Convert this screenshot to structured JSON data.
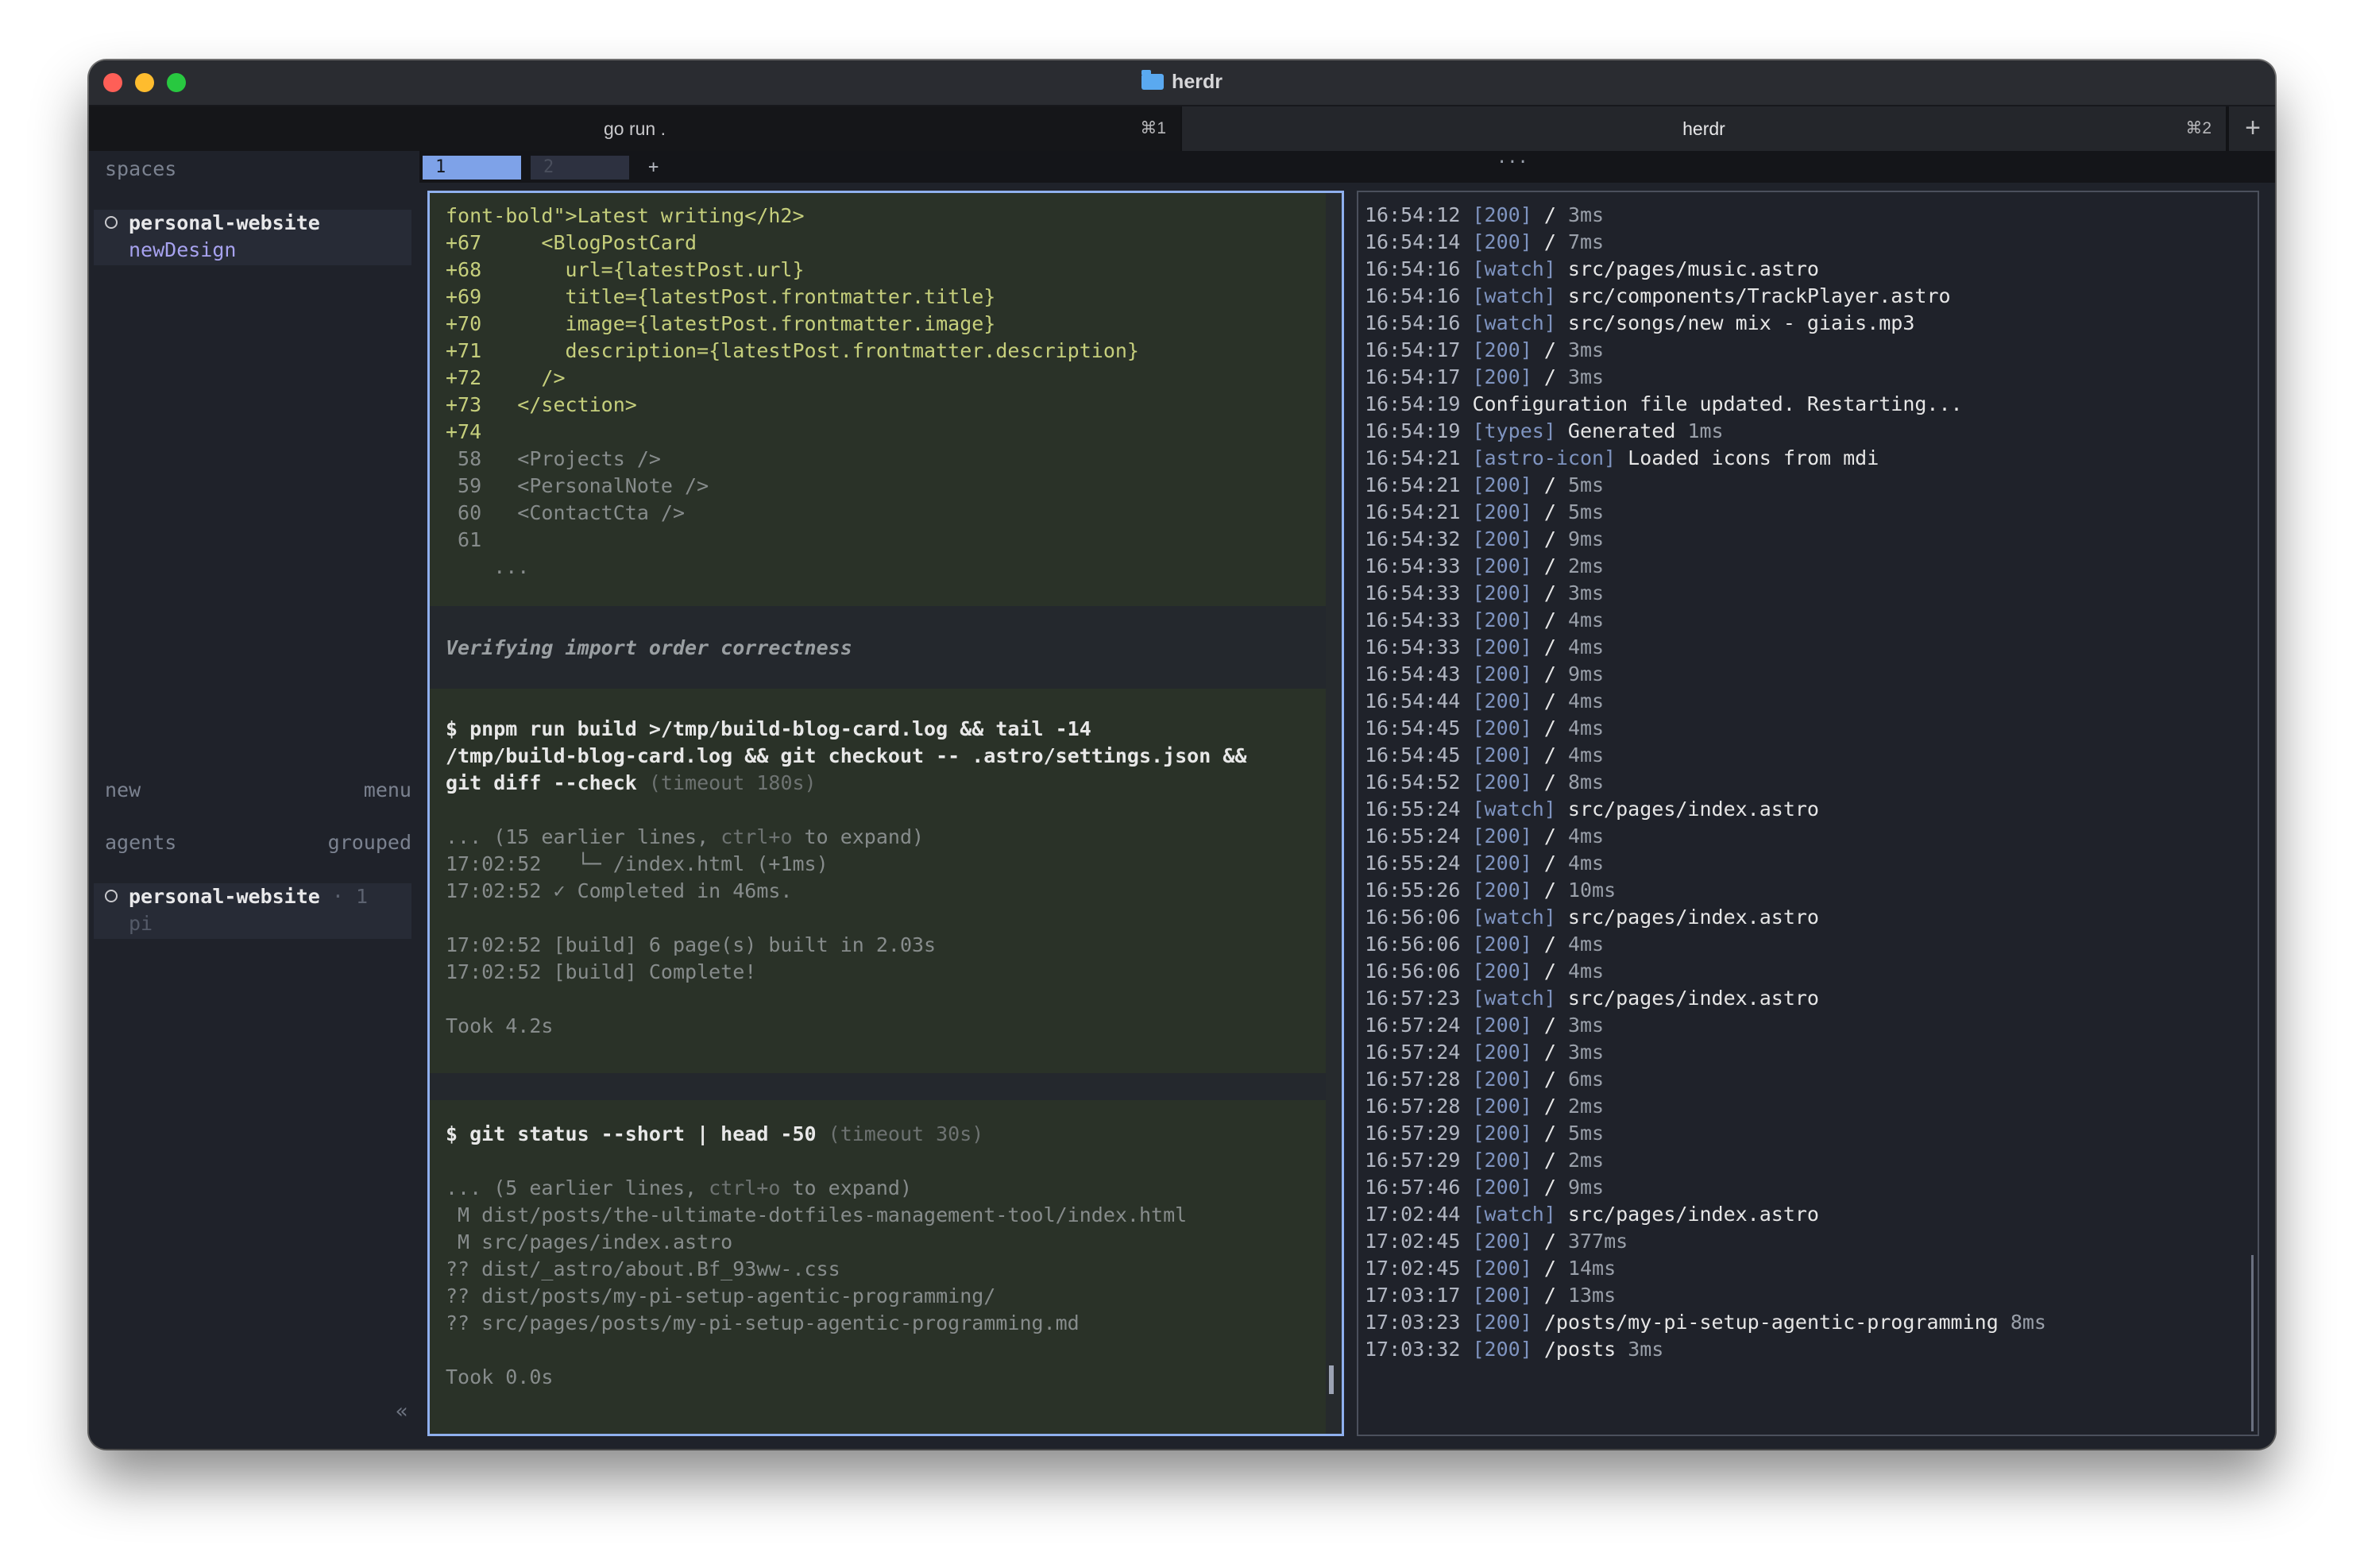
{
  "window": {
    "title": "herdr"
  },
  "tabs": [
    {
      "label": "go run .",
      "shortcut": "⌘1"
    },
    {
      "label": "herdr",
      "shortcut": "⌘2"
    }
  ],
  "tab_add": "+",
  "sidebar": {
    "spaces_header": "spaces",
    "space": {
      "name": "personal-website",
      "branch": "newDesign"
    },
    "new_label": "new",
    "menu_label": "menu",
    "agents_header": "agents",
    "agents_mode": "grouped",
    "agent": {
      "name": "personal-website",
      "count": " · 1",
      "sub": "pi"
    },
    "collapse": "«"
  },
  "workspace_tabs": {
    "tab1": "1",
    "tab2": "2",
    "add": "+",
    "overflow": "..."
  },
  "left_pane": {
    "diff": [
      "font-bold\">Latest writing</h2>",
      "+67     <BlogPostCard",
      "+68       url={latestPost.url}",
      "+69       title={latestPost.frontmatter.title}",
      "+70       image={latestPost.frontmatter.image}",
      "+71       description={latestPost.frontmatter.description}",
      "+72     />",
      "+73   </section>",
      "+74"
    ],
    "context": [
      " 58   <Projects />",
      " 59   <PersonalNote />",
      " 60   <ContactCta />",
      " 61",
      "    ..."
    ],
    "thinking": "Verifying import order correctness",
    "cmd1": {
      "lines": [
        "$ pnpm run build >/tmp/build-blog-card.log && tail -14",
        "/tmp/build-blog-card.log && git checkout -- .astro/settings.json &&",
        "git diff --check"
      ],
      "timeout": " (timeout 180s)",
      "expand_pre": "... (15 earlier lines, ",
      "expand_key": "ctrl+o",
      "expand_post": " to expand)",
      "output": [
        "17:02:52   └─ /index.html (+1ms)",
        "17:02:52 ✓ Completed in 46ms.",
        "",
        "17:02:52 [build] 6 page(s) built in 2.03s",
        "17:02:52 [build] Complete!"
      ],
      "took": "Took 4.2s"
    },
    "cmd2": {
      "line": "$ git status --short | head -50",
      "timeout": " (timeout 30s)",
      "expand_pre": "... (5 earlier lines, ",
      "expand_key": "ctrl+o",
      "expand_post": " to expand)",
      "output": [
        " M dist/posts/the-ultimate-dotfiles-management-tool/index.html",
        " M src/pages/index.astro",
        "?? dist/_astro/about.Bf_93ww-.css",
        "?? dist/posts/my-pi-setup-agentic-programming/",
        "?? src/pages/posts/my-pi-setup-agentic-programming.md"
      ],
      "took": "Took 0.0s"
    }
  },
  "log": [
    {
      "t": "16:54:12",
      "k": "[200]",
      "m": "/",
      "d": "3ms"
    },
    {
      "t": "16:54:14",
      "k": "[200]",
      "m": "/",
      "d": "7ms"
    },
    {
      "t": "16:54:16",
      "k": "[watch]",
      "m": "src/pages/music.astro",
      "d": ""
    },
    {
      "t": "16:54:16",
      "k": "[watch]",
      "m": "src/components/TrackPlayer.astro",
      "d": ""
    },
    {
      "t": "16:54:16",
      "k": "[watch]",
      "m": "src/songs/new mix - giais.mp3",
      "d": ""
    },
    {
      "t": "16:54:17",
      "k": "[200]",
      "m": "/",
      "d": "3ms"
    },
    {
      "t": "16:54:17",
      "k": "[200]",
      "m": "/",
      "d": "3ms"
    },
    {
      "t": "16:54:19",
      "k": "",
      "m": "Configuration file updated. Restarting...",
      "d": ""
    },
    {
      "t": "16:54:19",
      "k": "[types]",
      "m": "Generated",
      "d": "1ms"
    },
    {
      "t": "16:54:21",
      "k": "[astro-icon]",
      "m": "Loaded icons from mdi",
      "d": ""
    },
    {
      "t": "16:54:21",
      "k": "[200]",
      "m": "/",
      "d": "5ms"
    },
    {
      "t": "16:54:21",
      "k": "[200]",
      "m": "/",
      "d": "5ms"
    },
    {
      "t": "16:54:32",
      "k": "[200]",
      "m": "/",
      "d": "9ms"
    },
    {
      "t": "16:54:33",
      "k": "[200]",
      "m": "/",
      "d": "2ms"
    },
    {
      "t": "16:54:33",
      "k": "[200]",
      "m": "/",
      "d": "3ms"
    },
    {
      "t": "16:54:33",
      "k": "[200]",
      "m": "/",
      "d": "4ms"
    },
    {
      "t": "16:54:33",
      "k": "[200]",
      "m": "/",
      "d": "4ms"
    },
    {
      "t": "16:54:43",
      "k": "[200]",
      "m": "/",
      "d": "9ms"
    },
    {
      "t": "16:54:44",
      "k": "[200]",
      "m": "/",
      "d": "4ms"
    },
    {
      "t": "16:54:45",
      "k": "[200]",
      "m": "/",
      "d": "4ms"
    },
    {
      "t": "16:54:45",
      "k": "[200]",
      "m": "/",
      "d": "4ms"
    },
    {
      "t": "16:54:52",
      "k": "[200]",
      "m": "/",
      "d": "8ms"
    },
    {
      "t": "16:55:24",
      "k": "[watch]",
      "m": "src/pages/index.astro",
      "d": ""
    },
    {
      "t": "16:55:24",
      "k": "[200]",
      "m": "/",
      "d": "4ms"
    },
    {
      "t": "16:55:24",
      "k": "[200]",
      "m": "/",
      "d": "4ms"
    },
    {
      "t": "16:55:26",
      "k": "[200]",
      "m": "/",
      "d": "10ms"
    },
    {
      "t": "16:56:06",
      "k": "[watch]",
      "m": "src/pages/index.astro",
      "d": ""
    },
    {
      "t": "16:56:06",
      "k": "[200]",
      "m": "/",
      "d": "4ms"
    },
    {
      "t": "16:56:06",
      "k": "[200]",
      "m": "/",
      "d": "4ms"
    },
    {
      "t": "16:57:23",
      "k": "[watch]",
      "m": "src/pages/index.astro",
      "d": ""
    },
    {
      "t": "16:57:24",
      "k": "[200]",
      "m": "/",
      "d": "3ms"
    },
    {
      "t": "16:57:24",
      "k": "[200]",
      "m": "/",
      "d": "3ms"
    },
    {
      "t": "16:57:28",
      "k": "[200]",
      "m": "/",
      "d": "6ms"
    },
    {
      "t": "16:57:28",
      "k": "[200]",
      "m": "/",
      "d": "2ms"
    },
    {
      "t": "16:57:29",
      "k": "[200]",
      "m": "/",
      "d": "5ms"
    },
    {
      "t": "16:57:29",
      "k": "[200]",
      "m": "/",
      "d": "2ms"
    },
    {
      "t": "16:57:46",
      "k": "[200]",
      "m": "/",
      "d": "9ms"
    },
    {
      "t": "17:02:44",
      "k": "[watch]",
      "m": "src/pages/index.astro",
      "d": ""
    },
    {
      "t": "17:02:45",
      "k": "[200]",
      "m": "/",
      "d": "377ms"
    },
    {
      "t": "17:02:45",
      "k": "[200]",
      "m": "/",
      "d": "14ms"
    },
    {
      "t": "17:03:17",
      "k": "[200]",
      "m": "/",
      "d": "13ms"
    },
    {
      "t": "17:03:23",
      "k": "[200]",
      "m": "/posts/my-pi-setup-agentic-programming",
      "d": "8ms"
    },
    {
      "t": "17:03:32",
      "k": "[200]",
      "m": "/posts",
      "d": "3ms"
    }
  ]
}
